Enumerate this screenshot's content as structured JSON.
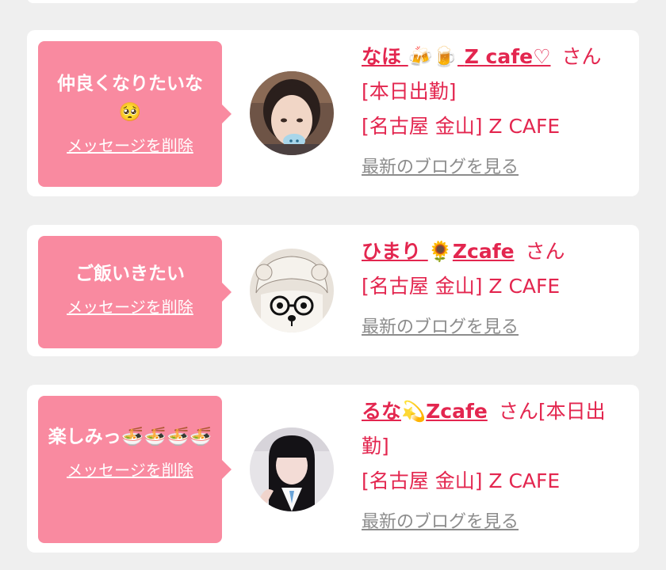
{
  "cards": [
    {
      "message": "仲良くなりたいな",
      "message_emoji": "🥺",
      "delete_label": "メッセージを削除",
      "cast_name": "なほ",
      "cast_name_emoji": "🍻🍺",
      "cast_name_suffix": "Z cafe♡",
      "san": "さん",
      "status": "[本日出勤]",
      "shop": "[名古屋 金山] Z CAFE",
      "blog_link": "最新のブログを見る"
    },
    {
      "message": "ご飯いきたい",
      "delete_label": "メッセージを削除",
      "cast_name": "ひまり",
      "cast_name_emoji": "🌻",
      "cast_name_suffix": "Zcafe",
      "san": "さん",
      "shop": "[名古屋 金山] Z CAFE",
      "blog_link": "最新のブログを見る"
    },
    {
      "message": "楽しみっ",
      "message_emoji": "🍜🍜🍜🍜",
      "delete_label": "メッセージを削除",
      "cast_name": "るな",
      "cast_name_emoji": "💫",
      "cast_name_suffix": "Zcafe",
      "san": "さん",
      "status_part1": "[本日出",
      "status_part2": "勤]",
      "shop": "[名古屋 金山] Z CAFE",
      "blog_link": "最新のブログを見る"
    }
  ],
  "colors": {
    "background": "#efefef",
    "card": "#ffffff",
    "bubble": "#f98aa0",
    "accent_text": "#e3264f",
    "muted_link": "#8c8c8c"
  }
}
